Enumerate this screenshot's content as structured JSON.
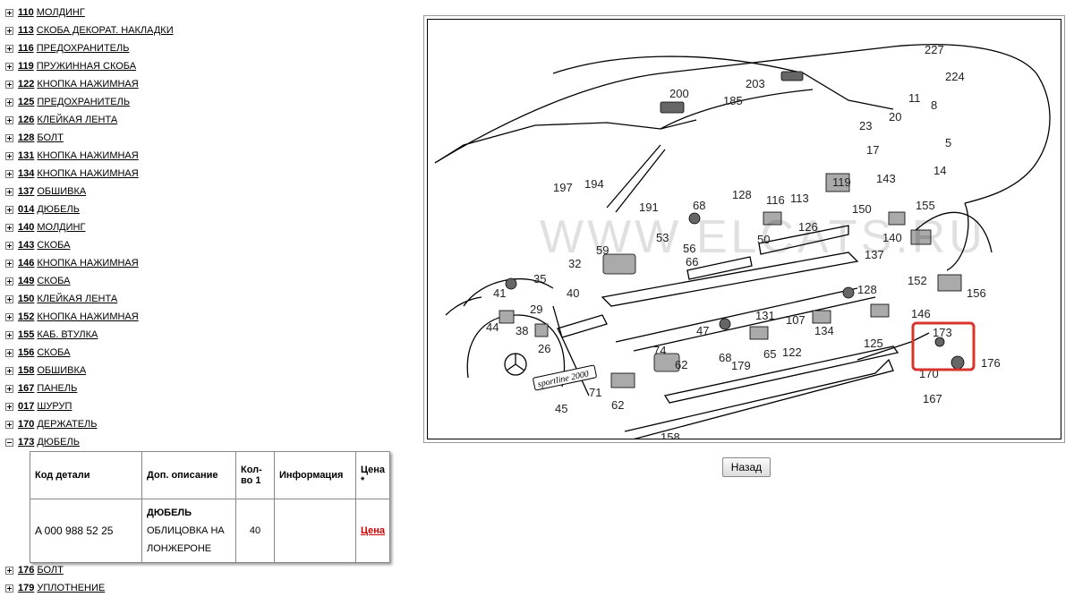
{
  "tree_items": [
    {
      "num": "110",
      "name": "МОЛДИНГ"
    },
    {
      "num": "113",
      "name": "СКОБА ДЕКОРАТ. НАКЛАДКИ"
    },
    {
      "num": "116",
      "name": "ПРЕДОХРАНИТЕЛЬ"
    },
    {
      "num": "119",
      "name": "ПРУЖИННАЯ СКОБА"
    },
    {
      "num": "122",
      "name": "КНОПКА НАЖИМНАЯ"
    },
    {
      "num": "125",
      "name": "ПРЕДОХРАНИТЕЛЬ"
    },
    {
      "num": "126",
      "name": "КЛЕЙКАЯ ЛЕНТА"
    },
    {
      "num": "128",
      "name": "БОЛТ"
    },
    {
      "num": "131",
      "name": "КНОПКА НАЖИМНАЯ"
    },
    {
      "num": "134",
      "name": "КНОПКА НАЖИМНАЯ"
    },
    {
      "num": "137",
      "name": "ОБШИВКА"
    },
    {
      "num": "014",
      "name": "ДЮБЕЛЬ"
    },
    {
      "num": "140",
      "name": "МОЛДИНГ"
    },
    {
      "num": "143",
      "name": "СКОБА"
    },
    {
      "num": "146",
      "name": "КНОПКА НАЖИМНАЯ"
    },
    {
      "num": "149",
      "name": "СКОБА"
    },
    {
      "num": "150",
      "name": "КЛЕЙКАЯ ЛЕНТА"
    },
    {
      "num": "152",
      "name": "КНОПКА НАЖИМНАЯ"
    },
    {
      "num": "155",
      "name": "КАБ. ВТУЛКА"
    },
    {
      "num": "156",
      "name": "СКОБА"
    },
    {
      "num": "158",
      "name": "ОБШИВКА"
    },
    {
      "num": "167",
      "name": "ПАНЕЛЬ"
    },
    {
      "num": "017",
      "name": "ШУРУП"
    },
    {
      "num": "170",
      "name": "ДЕРЖАТЕЛЬ"
    },
    {
      "num": "173",
      "name": "ДЮБЕЛЬ",
      "expanded": true
    }
  ],
  "tree_items_after": [
    {
      "num": "176",
      "name": "БОЛТ"
    },
    {
      "num": "179",
      "name": "УПЛОТНЕНИЕ"
    }
  ],
  "parts_table": {
    "headers": {
      "code": "Код детали",
      "desc": "Доп. описание",
      "qty_line1": "Кол-",
      "qty_line2": "во 1",
      "info": "Информация",
      "price_line1": "Цена",
      "price_line2": "*"
    },
    "row": {
      "code": "A  000 988 52 25",
      "desc_title": "ДЮБЕЛЬ",
      "desc_line1": "ОБЛИЦОВКА НА",
      "desc_line2": "ЛОНЖЕРОНЕ",
      "qty": "40",
      "info": "",
      "price": "Цена"
    }
  },
  "diagram": {
    "watermark": "WWW.ELCATS.RU",
    "badge_text": "sportline 2000",
    "highlighted": "173",
    "callouts": [
      "227",
      "224",
      "203",
      "185",
      "200",
      "11",
      "8",
      "20",
      "23",
      "17",
      "5",
      "14",
      "197",
      "194",
      "191",
      "68",
      "128",
      "116",
      "113",
      "119",
      "126",
      "150",
      "143",
      "155",
      "140",
      "137",
      "59",
      "53",
      "56",
      "50",
      "66",
      "32",
      "35",
      "41",
      "40",
      "29",
      "44",
      "38",
      "26",
      "152",
      "156",
      "128",
      "146",
      "125",
      "107",
      "134",
      "131",
      "122",
      "65",
      "68",
      "47",
      "74",
      "62",
      "179",
      "173",
      "176",
      "170",
      "167",
      "71",
      "62",
      "45",
      "158"
    ]
  },
  "back_button": "Назад",
  "colors": {
    "highlight": "#d9342b",
    "link_price": "#cc0000",
    "grid_label": "#5a9fa8"
  }
}
